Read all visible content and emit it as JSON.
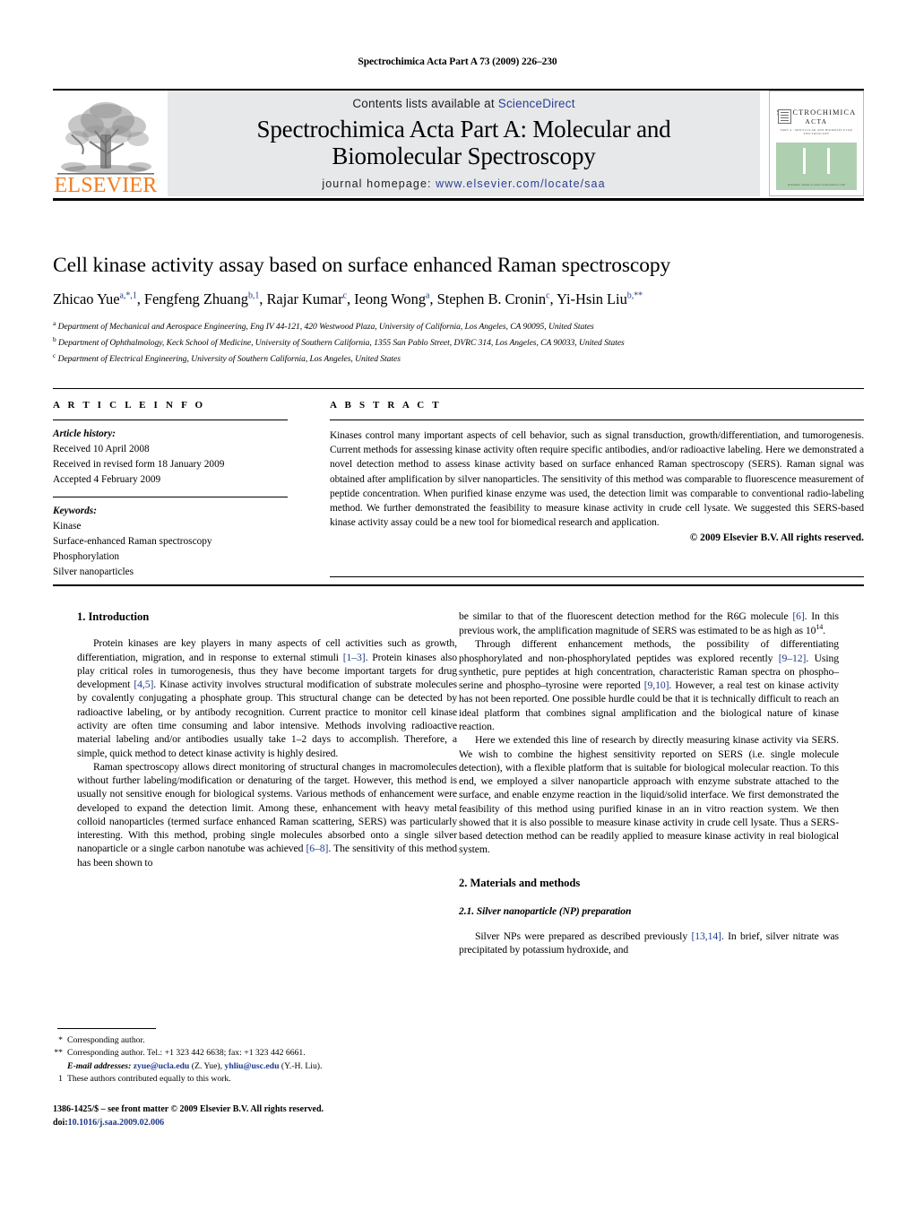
{
  "running_head": "Spectrochimica Acta Part A 73 (2009) 226–230",
  "masthead": {
    "contents_prefix": "Contents lists available at ",
    "sciencedirect": "ScienceDirect",
    "journal_title_line1": "Spectrochimica Acta Part A: Molecular and",
    "journal_title_line2": "Biomolecular Spectroscopy",
    "homepage_prefix": "journal homepage: ",
    "homepage_url": "www.elsevier.com/locate/saa",
    "publisher_logo_text": "ELSEVIER",
    "cover": {
      "name_line1": "SPECTROCHIMICA",
      "name_line2": "ACTA",
      "subtitle": "PART A : MOLECULAR AND BIOMOLECULAR SPECTROSCOPY",
      "footer": "Available online at www.sciencedirect.com",
      "green_hex": "#afcfb1"
    },
    "accent_orange": "#f07c20",
    "link_blue": "#2b3f94",
    "banner_gray": "#e7e8e9"
  },
  "title": "Cell kinase activity assay based on surface enhanced Raman spectroscopy",
  "authors_html": "Zhicao Yue<sup>a,*,1</sup>, Fengfeng Zhuang<sup>b,1</sup>, Rajar Kumar<sup>c</sup>, Ieong Wong<sup>a</sup>, Stephen B. Cronin<sup>c</sup>, Yi-Hsin Liu<sup>b,**</sup>",
  "affiliations": [
    {
      "mark": "a",
      "text": "Department of Mechanical and Aerospace Engineering, Eng IV 44-121, 420 Westwood Plaza, University of California, Los Angeles, CA 90095, United States"
    },
    {
      "mark": "b",
      "text": "Department of Ophthalmology, Keck School of Medicine, University of Southern California, 1355 San Pablo Street, DVRC 314, Los Angeles, CA 90033, United States"
    },
    {
      "mark": "c",
      "text": "Department of Electrical Engineering, University of Southern California, Los Angeles, United States"
    }
  ],
  "article_info": {
    "heading": "A R T I C L E    I N F O",
    "history_label": "Article history:",
    "history": [
      "Received 10 April 2008",
      "Received in revised form 18 January 2009",
      "Accepted 4 February 2009"
    ],
    "keywords_label": "Keywords:",
    "keywords": [
      "Kinase",
      "Surface-enhanced Raman spectroscopy",
      "Phosphorylation",
      "Silver nanoparticles"
    ]
  },
  "abstract": {
    "heading": "A B S T R A C T",
    "text": "Kinases control many important aspects of cell behavior, such as signal transduction, growth/differentiation, and tumorogenesis. Current methods for assessing kinase activity often require specific antibodies, and/or radioactive labeling. Here we demonstrated a novel detection method to assess kinase activity based on surface enhanced Raman spectroscopy (SERS). Raman signal was obtained after amplification by silver nanoparticles. The sensitivity of this method was comparable to fluorescence measurement of peptide concentration. When purified kinase enzyme was used, the detection limit was comparable to conventional radio-labeling method. We further demonstrated the feasibility to measure kinase activity in crude cell lysate. We suggested this SERS-based kinase activity assay could be a new tool for biomedical research and application.",
    "copyright": "© 2009 Elsevier B.V. All rights reserved."
  },
  "body": {
    "section1_title": "1.  Introduction",
    "p1_html": "Protein kinases are key players in many aspects of cell activities such as growth, differentiation, migration, and in response to external stimuli <span class=\"ref\">[1–3]</span>. Protein kinases also play critical roles in tumorogenesis, thus they have become important targets for drug development <span class=\"ref\">[4,5]</span>. Kinase activity involves structural modification of substrate molecules by covalently conjugating a phosphate group. This structural change can be detected by radioactive labeling, or by antibody recognition. Current practice to monitor cell kinase activity are often time consuming and labor intensive. Methods involving radioactive material labeling and/or antibodies usually take 1–2 days to accomplish. Therefore, a simple, quick method to detect kinase activity is highly desired.",
    "p2_html": "Raman spectroscopy allows direct monitoring of structural changes in macromolecules without further labeling/modification or denaturing of the target. However, this method is usually not sensitive enough for biological systems. Various methods of enhancement were developed to expand the detection limit. Among these, enhancement with heavy metal colloid nanoparticles (termed surface enhanced Raman scattering, SERS) was particularly interesting. With this method, probing single molecules absorbed onto a single silver nanoparticle or a single carbon nanotube was achieved <span class=\"ref\">[6–8]</span>. The sensitivity of this method has been shown to",
    "p3_html": "be similar to that of the fluorescent detection method for the R6G molecule <span class=\"ref\">[6]</span>. In this previous work, the amplification magnitude of SERS was estimated to be as high as 10<sup class=\"num\">14</sup>.",
    "p4_html": "Through different enhancement methods, the possibility of differentiating phosphorylated and non-phosphorylated peptides was explored recently <span class=\"ref\">[9–12]</span>. Using synthetic, pure peptides at high concentration, characteristic Raman spectra on phospho–serine and phospho–tyrosine were reported <span class=\"ref\">[9,10]</span>. However, a real test on kinase activity has not been reported. One possible hurdle could be that it is technically difficult to reach an ideal platform that combines signal amplification and the biological nature of kinase reaction.",
    "p5_html": "Here we extended this line of research by directly measuring kinase activity via SERS. We wish to combine the highest sensitivity reported on SERS (i.e. single molecule detection), with a flexible platform that is suitable for biological molecular reaction. To this end, we employed a silver nanoparticle approach with enzyme substrate attached to the surface, and enable enzyme reaction in the liquid/solid interface. We first demonstrated the feasibility of this method using purified kinase in an in vitro reaction system. We then showed that it is also possible to measure kinase activity in crude cell lysate. Thus a SERS-based detection method can be readily applied to measure kinase activity in real biological system.",
    "section2_title": "2.  Materials and methods",
    "subsection21_title": "2.1.  Silver nanoparticle (NP) preparation",
    "p6_html": "Silver NPs were prepared as described previously <span class=\"ref\">[13,14]</span>. In brief, silver nitrate was precipitated by potassium hydroxide, and"
  },
  "footnotes": [
    {
      "mark": "*",
      "html": "Corresponding author."
    },
    {
      "mark": "**",
      "html": "Corresponding author. Tel.: +1 323 442 6638; fax: +1 323 442 6661."
    },
    {
      "mark": "",
      "html": "<span class=\"em\">E-mail addresses:</span> <span class=\"mail\">zyue@ucla.edu</span> (Z. Yue), <span class=\"mail\">yhliu@usc.edu</span> (Y.-H. Liu)."
    },
    {
      "mark": "1",
      "html": "These authors contributed equally to this work."
    }
  ],
  "imprint": {
    "line1": "1386-1425/$ – see front matter © 2009 Elsevier B.V. All rights reserved.",
    "doi_prefix": "doi:",
    "doi": "10.1016/j.saa.2009.02.006"
  }
}
